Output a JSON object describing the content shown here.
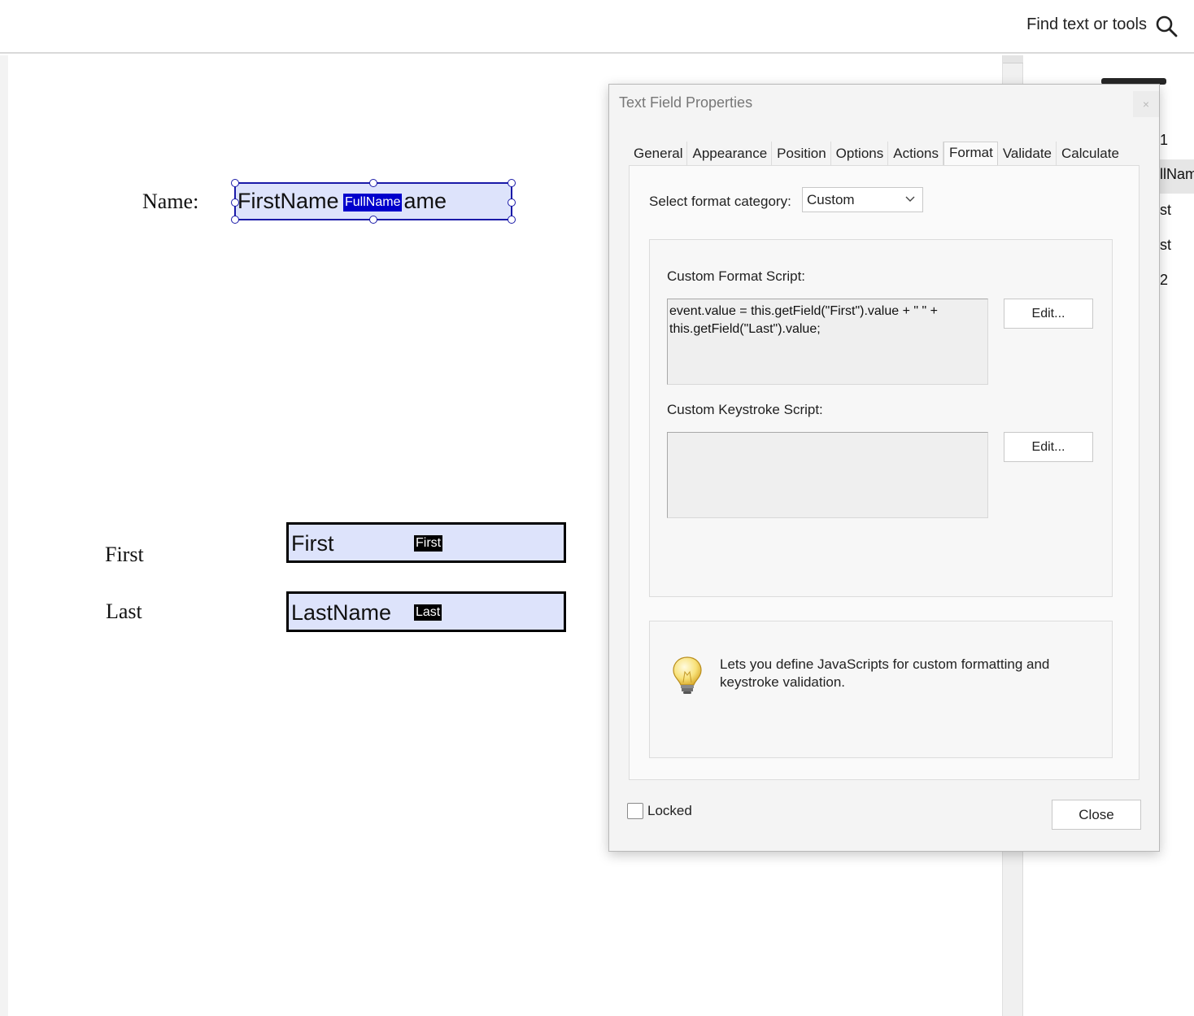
{
  "topbar": {
    "search_label": "Find text or tools"
  },
  "document": {
    "name_label": "Name:",
    "fullname_field": {
      "value": "FirstName",
      "tail": "ame",
      "tag": "FullName"
    },
    "first_label": "First",
    "first_field": {
      "value": "First",
      "tag": "First"
    },
    "last_label": "Last",
    "last_field": {
      "value": "LastName",
      "tag": "Last"
    }
  },
  "right_panel": {
    "items": [
      "1",
      "llNam",
      "st",
      "st",
      "2"
    ]
  },
  "dialog": {
    "title": "Text Field Properties",
    "close_glyph": "×",
    "tabs": [
      {
        "label": "General"
      },
      {
        "label": "Appearance"
      },
      {
        "label": "Position"
      },
      {
        "label": "Options"
      },
      {
        "label": "Actions"
      },
      {
        "label": "Format"
      },
      {
        "label": "Validate"
      },
      {
        "label": "Calculate"
      }
    ],
    "active_tab": "Format",
    "format": {
      "category_label": "Select format category:",
      "category_value": "Custom",
      "custom_format_label": "Custom Format Script:",
      "custom_format_script": "event.value = this.getField(\"First\").value + \" \" +\nthis.getField(\"Last\").value;",
      "custom_keystroke_label": "Custom Keystroke Script:",
      "custom_keystroke_script": "",
      "edit_label": "Edit...",
      "info_text": "Lets you define JavaScripts for custom formatting and keystroke validation."
    },
    "locked_label": "Locked",
    "locked_checked": false,
    "close_label": "Close"
  }
}
